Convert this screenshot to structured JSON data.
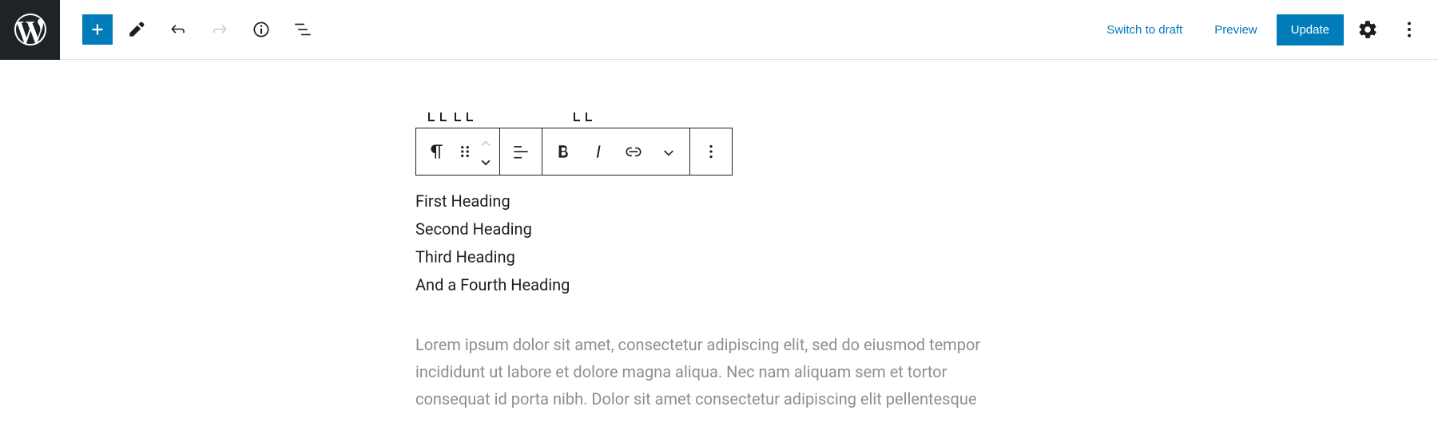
{
  "header": {
    "switch_to_draft": "Switch to draft",
    "preview": "Preview",
    "update": "Update"
  },
  "content": {
    "headings": [
      "First Heading",
      "Second Heading",
      "Third Heading",
      "And a Fourth Heading"
    ],
    "paragraph": "Lorem ipsum dolor sit amet, consectetur adipiscing elit, sed do eiusmod tempor incididunt ut labore et dolore magna aliqua. Nec nam aliquam sem et tortor consequat id porta nibh. Dolor sit amet consectetur adipiscing elit pellentesque"
  }
}
